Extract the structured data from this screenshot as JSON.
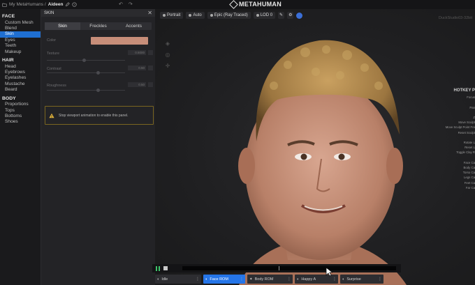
{
  "topbar": {
    "breadcrumb_root": "My MetaHumans /",
    "breadcrumb_current": "Aideen",
    "undo_glyph": "↶",
    "redo_glyph": "↷",
    "logo_text": "METAHUMAN"
  },
  "nav": {
    "groups": [
      {
        "title": "FACE",
        "items": [
          "Custom Mesh",
          "Blend",
          "Skin",
          "Eyes",
          "Teeth",
          "Makeup"
        ],
        "active": "Skin"
      },
      {
        "title": "HAIR",
        "items": [
          "Head",
          "Eyebrows",
          "Eyelashes",
          "Mustache",
          "Beard"
        ]
      },
      {
        "title": "BODY",
        "items": [
          "Proportions",
          "Tops",
          "Bottoms",
          "Shoes"
        ]
      }
    ]
  },
  "panel": {
    "title": "SKIN",
    "close_glyph": "✕",
    "tabs": [
      {
        "label": "Skin",
        "active": true
      },
      {
        "label": "Freckles",
        "active": false
      },
      {
        "label": "Accents",
        "active": false
      }
    ],
    "color_label": "Color",
    "color_value": "#c78e79",
    "sliders": [
      {
        "label": "Texture",
        "value": "0.5000",
        "fraction": 0.48
      },
      {
        "label": "Contrast",
        "value": "0.50",
        "fraction": 0.66
      },
      {
        "label": "Roughness",
        "value": "0.50",
        "fraction": 0.66
      }
    ],
    "warning": "Stop viewport animation to enable this panel."
  },
  "viewport": {
    "toolbar": [
      "Portrait",
      "Auto",
      "Epic (Ray Traced)",
      "LOD 0"
    ],
    "asset_name": "DuckStudio03-32bit",
    "hotkeys_title": "HOTKEY P",
    "hotkeys": [
      "Focus",
      "",
      "Pan",
      "",
      "Z",
      "Move Sculpt",
      "Move Sculpt Point Fre",
      "Reset Sculpt",
      "",
      "Rotate L",
      "Reset L",
      "Toggle Clay R",
      "",
      "Face Ca",
      "Body Ca",
      "Torso Ca",
      "Legs Ca",
      "Feet Ca",
      "Far Ca"
    ]
  },
  "timeline": {
    "playhead_fraction": 0.45,
    "animations": [
      {
        "label": "Idle",
        "active": false
      },
      {
        "label": "Face ROM",
        "active": true
      },
      {
        "label": "Body ROM",
        "active": false
      },
      {
        "label": "Happy A",
        "active": false
      },
      {
        "label": "Surprise",
        "active": false
      }
    ],
    "more_glyph": "⋮"
  },
  "colors": {
    "accent": "#1f6fd1",
    "play": "#3dc46a",
    "warning_border": "#7a6620",
    "skin_swatch": "#c78e79",
    "hair": "#b08a4a"
  }
}
